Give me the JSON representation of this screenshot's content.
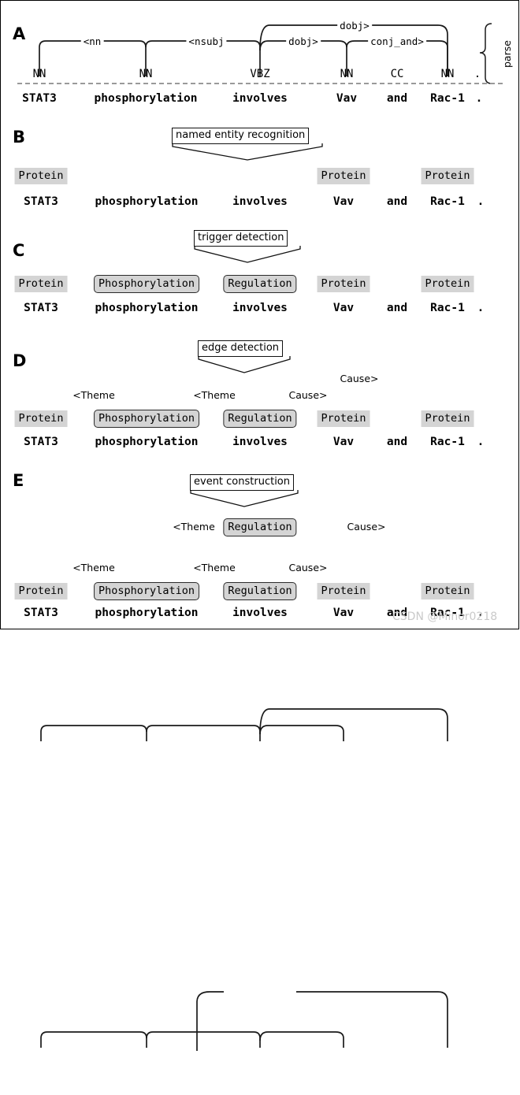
{
  "figure": {
    "sentence_tokens": [
      "STAT3",
      "phosphorylation",
      "involves",
      "Vav",
      "and",
      "Rac-1",
      "."
    ],
    "watermark": "CSDN @Minor0218"
  },
  "panels": {
    "a": {
      "letter": "A",
      "side_label": "parse",
      "pos_tags": [
        "NN",
        "NN",
        "VBZ",
        "NN",
        "CC",
        "NN",
        "."
      ],
      "words": [
        "STAT3",
        "phosphorylation",
        "involves",
        "Vav",
        "and",
        "Rac-1",
        "."
      ],
      "edges": [
        {
          "label": "<nn",
          "from": "STAT3",
          "to": "phosphorylation"
        },
        {
          "label": "<nsubj",
          "from": "phosphorylation",
          "to": "involves"
        },
        {
          "label": "dobj>",
          "from": "involves",
          "to": "Vav"
        },
        {
          "label": "conj_and>",
          "from": "Vav",
          "to": "Rac-1"
        },
        {
          "label": "dobj>",
          "from": "involves",
          "to": "Rac-1"
        }
      ]
    },
    "b": {
      "letter": "B",
      "process": "named entity recognition",
      "words": [
        "STAT3",
        "phosphorylation",
        "involves",
        "Vav",
        "and",
        "Rac-1",
        "."
      ],
      "tags": [
        {
          "text": "Protein",
          "token": "STAT3",
          "style": "plain"
        },
        {
          "text": "Protein",
          "token": "Vav",
          "style": "plain"
        },
        {
          "text": "Protein",
          "token": "Rac-1",
          "style": "plain"
        }
      ]
    },
    "c": {
      "letter": "C",
      "process": "trigger detection",
      "words": [
        "STAT3",
        "phosphorylation",
        "involves",
        "Vav",
        "and",
        "Rac-1",
        "."
      ],
      "tags": [
        {
          "text": "Protein",
          "token": "STAT3",
          "style": "plain"
        },
        {
          "text": "Phosphorylation",
          "token": "phosphorylation",
          "style": "boxed"
        },
        {
          "text": "Regulation",
          "token": "involves",
          "style": "boxed"
        },
        {
          "text": "Protein",
          "token": "Vav",
          "style": "plain"
        },
        {
          "text": "Protein",
          "token": "Rac-1",
          "style": "plain"
        }
      ]
    },
    "d": {
      "letter": "D",
      "process": "edge detection",
      "words": [
        "STAT3",
        "phosphorylation",
        "involves",
        "Vav",
        "and",
        "Rac-1",
        "."
      ],
      "tags": [
        {
          "text": "Protein",
          "token": "STAT3",
          "style": "plain"
        },
        {
          "text": "Phosphorylation",
          "token": "phosphorylation",
          "style": "boxed"
        },
        {
          "text": "Regulation",
          "token": "involves",
          "style": "boxed"
        },
        {
          "text": "Protein",
          "token": "Vav",
          "style": "plain"
        },
        {
          "text": "Protein",
          "token": "Rac-1",
          "style": "plain"
        }
      ],
      "edges": [
        {
          "label": "<Theme",
          "from": "Phosphorylation",
          "to": "Protein(STAT3)"
        },
        {
          "label": "<Theme",
          "from": "Regulation",
          "to": "Phosphorylation"
        },
        {
          "label": "Cause>",
          "from": "Regulation",
          "to": "Protein(Vav)"
        },
        {
          "label": "Cause>",
          "from": "Regulation",
          "to": "Protein(Rac-1)"
        }
      ]
    },
    "e": {
      "letter": "E",
      "process": "event construction",
      "words": [
        "STAT3",
        "phosphorylation",
        "involves",
        "Vav",
        "and",
        "Rac-1",
        "."
      ],
      "tags": [
        {
          "text": "Protein",
          "token": "STAT3",
          "style": "plain"
        },
        {
          "text": "Phosphorylation",
          "token": "phosphorylation",
          "style": "boxed"
        },
        {
          "text": "Regulation",
          "token": "involves",
          "style": "boxed"
        },
        {
          "text": "Protein",
          "token": "Vav",
          "style": "plain"
        },
        {
          "text": "Protein",
          "token": "Rac-1",
          "style": "plain"
        }
      ],
      "event_node": {
        "text": "Regulation",
        "style": "boxed"
      },
      "edges": [
        {
          "label": "<Theme",
          "from": "Regulation(event)",
          "to": "Phosphorylation"
        },
        {
          "label": "Cause>",
          "from": "Regulation(event)",
          "to": "Protein(Rac-1)"
        },
        {
          "label": "<Theme",
          "from": "Phosphorylation",
          "to": "Protein(STAT3)"
        },
        {
          "label": "<Theme",
          "from": "Regulation",
          "to": "Phosphorylation"
        },
        {
          "label": "Cause>",
          "from": "Regulation",
          "to": "Protein(Vav)"
        }
      ]
    }
  }
}
